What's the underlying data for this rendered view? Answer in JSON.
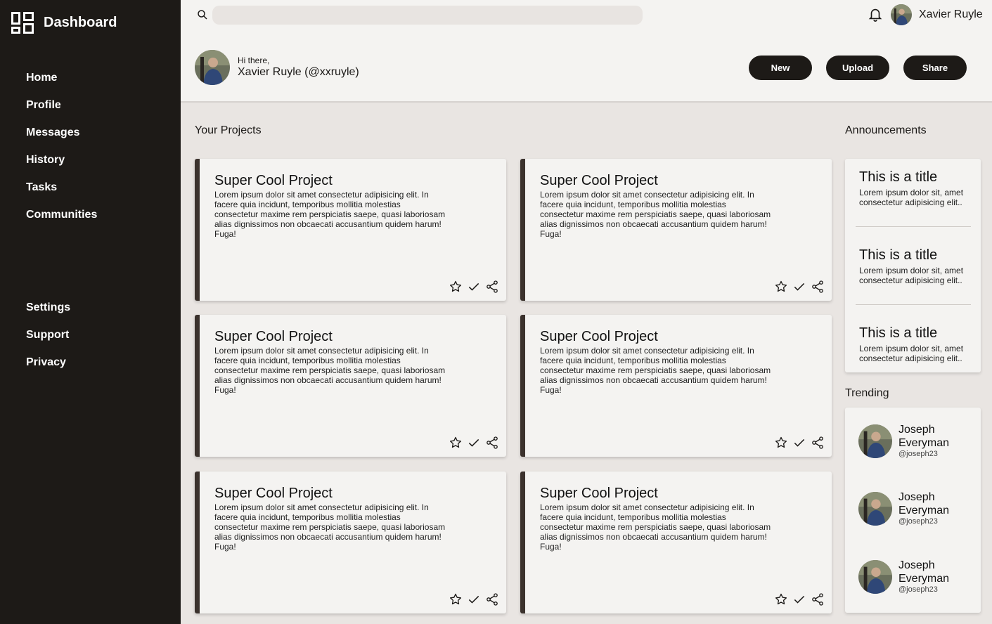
{
  "brand": {
    "title": "Dashboard"
  },
  "nav": {
    "main": [
      {
        "label": "Home"
      },
      {
        "label": "Profile"
      },
      {
        "label": "Messages"
      },
      {
        "label": "History"
      },
      {
        "label": "Tasks"
      },
      {
        "label": "Communities"
      }
    ],
    "bottom": [
      {
        "label": "Settings"
      },
      {
        "label": "Support"
      },
      {
        "label": "Privacy"
      }
    ]
  },
  "topbar": {
    "search_placeholder": "",
    "username": "Xavier Ruyle"
  },
  "greeting": {
    "small": "Hi there,",
    "name": "Xavier Ruyle (@xxruyle)"
  },
  "actions": {
    "new_label": "New",
    "upload_label": "Upload",
    "share_label": "Share"
  },
  "projects": {
    "heading": "Your Projects",
    "cards": [
      {
        "title": "Super Cool Project",
        "body": "Lorem ipsum dolor sit amet consectetur adipisicing elit. In facere quia incidunt, temporibus mollitia molestias consectetur maxime rem perspiciatis saepe, quasi laboriosam alias dignissimos non obcaecati accusantium quidem harum! Fuga!"
      },
      {
        "title": "Super Cool Project",
        "body": "Lorem ipsum dolor sit amet consectetur adipisicing elit. In facere quia incidunt, temporibus mollitia molestias consectetur maxime rem perspiciatis saepe, quasi laboriosam alias dignissimos non obcaecati accusantium quidem harum! Fuga!"
      },
      {
        "title": "Super Cool Project",
        "body": "Lorem ipsum dolor sit amet consectetur adipisicing elit. In facere quia incidunt, temporibus mollitia molestias consectetur maxime rem perspiciatis saepe, quasi laboriosam alias dignissimos non obcaecati accusantium quidem harum! Fuga!"
      },
      {
        "title": "Super Cool Project",
        "body": "Lorem ipsum dolor sit amet consectetur adipisicing elit. In facere quia incidunt, temporibus mollitia molestias consectetur maxime rem perspiciatis saepe, quasi laboriosam alias dignissimos non obcaecati accusantium quidem harum! Fuga!"
      },
      {
        "title": "Super Cool Project",
        "body": "Lorem ipsum dolor sit amet consectetur adipisicing elit. In facere quia incidunt, temporibus mollitia molestias consectetur maxime rem perspiciatis saepe, quasi laboriosam alias dignissimos non obcaecati accusantium quidem harum! Fuga!"
      },
      {
        "title": "Super Cool Project",
        "body": "Lorem ipsum dolor sit amet consectetur adipisicing elit. In facere quia incidunt, temporibus mollitia molestias consectetur maxime rem perspiciatis saepe, quasi laboriosam alias dignissimos non obcaecati accusantium quidem harum! Fuga!"
      }
    ],
    "card_icons": [
      "star-icon",
      "check-icon",
      "share-icon"
    ]
  },
  "announcements": {
    "heading": "Announcements",
    "items": [
      {
        "title": "This is a title",
        "text": "Lorem ipsum dolor sit, amet consectetur adipisicing elit.."
      },
      {
        "title": "This is a title",
        "text": "Lorem ipsum dolor sit, amet consectetur adipisicing elit.."
      },
      {
        "title": "This is a title",
        "text": "Lorem ipsum dolor sit, amet consectetur adipisicing elit.."
      }
    ]
  },
  "trending": {
    "heading": "Trending",
    "items": [
      {
        "name": "Joseph Everyman",
        "handle": "@joseph23"
      },
      {
        "name": "Joseph Everyman",
        "handle": "@joseph23"
      },
      {
        "name": "Joseph Everyman",
        "handle": "@joseph23"
      }
    ]
  },
  "colors": {
    "sidebar_bg": "#1d1a17",
    "page_bg": "#e9e5e2",
    "card_bg": "#f4f3f1",
    "card_accent": "#3b322d",
    "button_bg": "#1d1a17"
  }
}
